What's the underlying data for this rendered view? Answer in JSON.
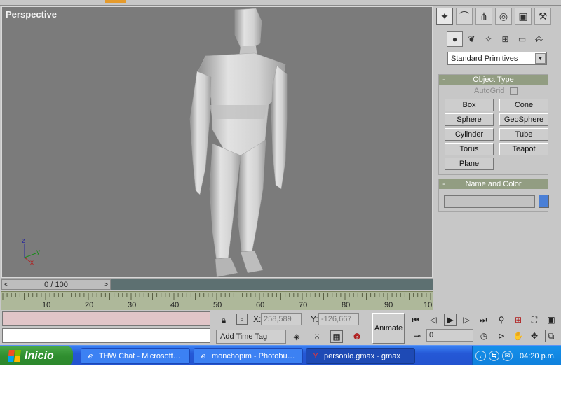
{
  "viewport": {
    "label": "Perspective"
  },
  "axis": {
    "z": "z",
    "y": "y",
    "x": "x"
  },
  "time_slider": {
    "frame_text": "0 / 100",
    "prev": "<",
    "next": ">"
  },
  "trackbar": {
    "ticks": [
      "10",
      "20",
      "30",
      "40",
      "50",
      "60",
      "70",
      "80",
      "90",
      "10"
    ]
  },
  "command_panel": {
    "tabs": [
      {
        "icon": "create-tab-icon",
        "glyph": "✦"
      },
      {
        "icon": "modify-tab-icon",
        "glyph": "⌒"
      },
      {
        "icon": "hierarchy-tab-icon",
        "glyph": "⋔"
      },
      {
        "icon": "motion-tab-icon",
        "glyph": "◎"
      },
      {
        "icon": "display-tab-icon",
        "glyph": "▣"
      },
      {
        "icon": "utilities-tab-icon",
        "glyph": "⚒"
      }
    ],
    "categories": [
      {
        "icon": "geometry-icon",
        "glyph": "●"
      },
      {
        "icon": "shapes-icon",
        "glyph": "❦"
      },
      {
        "icon": "lights-icon",
        "glyph": "✧"
      },
      {
        "icon": "cameras-icon",
        "glyph": "⊞"
      },
      {
        "icon": "helpers-icon",
        "glyph": "▭"
      },
      {
        "icon": "spacewarps-icon",
        "glyph": "⁂"
      }
    ],
    "dropdown": {
      "value": "Standard Primitives",
      "arrow": "▼"
    },
    "object_type": {
      "minus": "-",
      "title": "Object Type",
      "autogrid": "AutoGrid",
      "buttons": [
        "Box",
        "Cone",
        "Sphere",
        "GeoSphere",
        "Cylinder",
        "Tube",
        "Torus",
        "Teapot",
        "Plane"
      ]
    },
    "name_color": {
      "minus": "-",
      "title": "Name and Color",
      "name_value": "",
      "swatch_color": "#4a7fd6"
    }
  },
  "status": {
    "prompt1": "",
    "prompt2": "",
    "x_label": "X:",
    "x_value": "258,589",
    "y_label": "Y:",
    "y_value": "-126,667",
    "add_time_tag": "Add Time Tag",
    "animate": "Animate",
    "frame_value": "0"
  },
  "taskbar": {
    "start": "Inicio",
    "tasks": [
      {
        "label": "THW Chat - Microsoft…",
        "icon": "ie-icon"
      },
      {
        "label": "monchopim - Photobu…",
        "icon": "ie-icon"
      },
      {
        "label": "personlo.gmax - gmax",
        "icon": "gmax-icon"
      }
    ],
    "clock": "04:20 p.m."
  },
  "colors": {
    "viewport_bg": "#7b7b7b",
    "rollout_head": "#929d82",
    "taskbar": "#2558d6",
    "start": "#2f8e2f",
    "time_slider": "#5d7071"
  }
}
